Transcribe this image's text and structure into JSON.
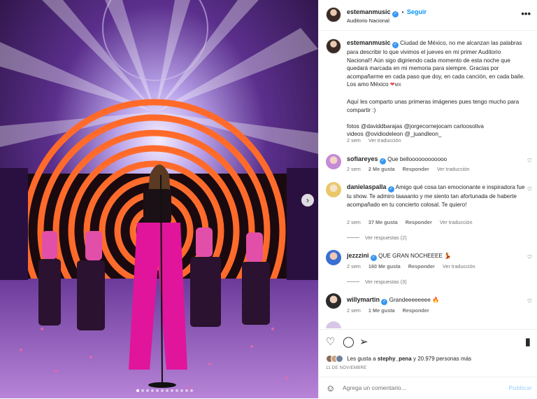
{
  "header": {
    "username": "estemanmusic",
    "separator": "•",
    "follow_label": "Seguir",
    "location": "Auditorio Nacional",
    "more_label": "•••"
  },
  "caption": {
    "username": "estemanmusic",
    "text": "Ciudad de México, no me alcanzan las palabras para describir lo que vivimos el jueves en mi primer Auditorio Nacional!! Aún sigo digiriendo cada momento de esta noche que quedará marcada en mi memoria para siempre. Gracias por acompañarme en cada paso que doy, en cada canción, en cada baile. Los amo México",
    "flag_text": "MX",
    "paragraph2": "Aquí les comparto unas primeras imágenes pues tengo mucho para compartir :)",
    "credits_photos": "fotos @daviddbarajas @jorgecornejocam carloosoliva",
    "credits_videos": "videos @ovidiodeleon @_juandleon_",
    "time": "2 sem",
    "translate": "Ver traducción"
  },
  "comments": [
    {
      "username": "sofiareyes",
      "verified": true,
      "text": "Que belloooooooooooo",
      "time": "2 sem",
      "likes": "2 Me gusta",
      "reply": "Responder",
      "translate": "Ver traducción",
      "replies": ""
    },
    {
      "username": "danielaspalla",
      "verified": true,
      "text": "Amigo qué cosa tan emocionante e inspiradora fue tu show. Te admiro taaaanto y me siento tan afortunada de haberte acompañado en tu concierto colosal. Te quiero!",
      "time": "2 sem",
      "likes": "37 Me gusta",
      "reply": "Responder",
      "translate": "Ver traducción",
      "replies": "Ver respuestas (2)"
    },
    {
      "username": "jezzzini",
      "verified": true,
      "text": "QUE GRAN NOCHEEEE",
      "time": "2 sem",
      "likes": "160 Me gusta",
      "reply": "Responder",
      "translate": "Ver traducción",
      "replies": "Ver respuestas (3)"
    },
    {
      "username": "willymartin",
      "verified": true,
      "text": "Grandeeeeeeee",
      "time": "2 sem",
      "likes": "1 Me gusta",
      "reply": "Responder",
      "translate": "",
      "replies": ""
    }
  ],
  "likes_text": "Les gusta a",
  "likes_user": "stephy_pena",
  "likes_rest": "y 20.979 personas más",
  "date": "11 DE NOVIEMBRE",
  "composer": {
    "placeholder": "Agrega un comentario...",
    "publish_label": "Publicar"
  },
  "colors": {
    "accent": "#0095f6",
    "verified": "#3897f0",
    "like_red": "#ed4956"
  },
  "carousel": {
    "slide_count": 12,
    "active_slide": 1
  }
}
